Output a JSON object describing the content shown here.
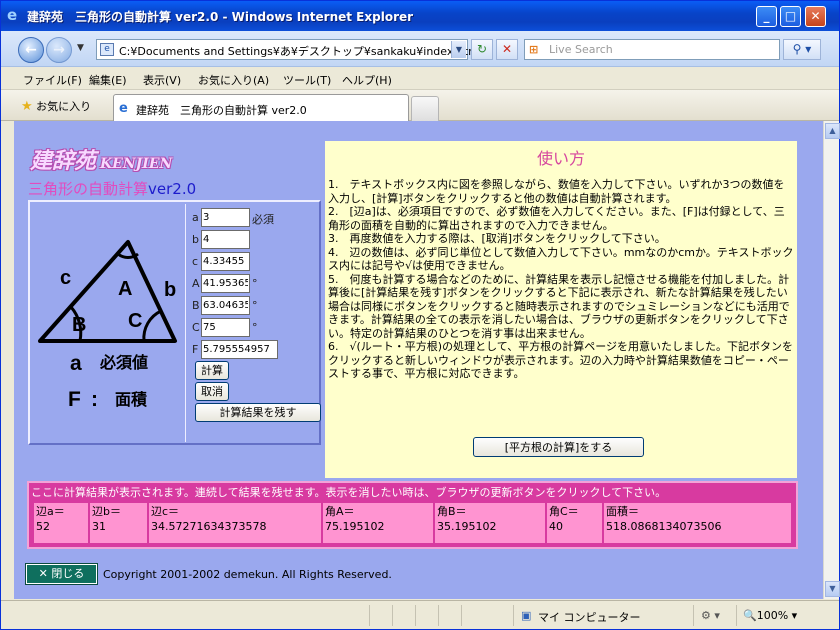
{
  "window": {
    "title": "建辞苑　三角形の自動計算 ver2.0 - Windows Internet Explorer",
    "minimize": "_",
    "maximize": "□",
    "close": "✕"
  },
  "address": {
    "url": "C:¥Documents and Settings¥あ¥デスクトップ¥sankaku¥index.htm",
    "search_placeholder": "Live Search"
  },
  "menu": [
    "ファイル(F)",
    "編集(E)",
    "表示(V)",
    "お気に入り(A)",
    "ツール(T)",
    "ヘルプ(H)"
  ],
  "favorites_label": "お気に入り",
  "tab_title": "建辞苑　三角形の自動計算 ver2.0",
  "page": {
    "logo_kanji": "建辞苑",
    "logo_en": "KENJIEN",
    "app_title": "三角形の自動計算",
    "app_version": "ver2.0",
    "diagram": {
      "label_c": "c",
      "label_b": "b",
      "label_A": "A",
      "label_B": "B",
      "label_C": "C",
      "label_a": "a",
      "required": "必須値",
      "label_F": "F",
      "colon": ":",
      "area": "面積"
    },
    "form": {
      "a": {
        "label": "a",
        "value": "3",
        "suffix": "必須"
      },
      "b": {
        "label": "b",
        "value": "4"
      },
      "c": {
        "label": "c",
        "value": "4.33455"
      },
      "A": {
        "label": "A",
        "value": "41.95365",
        "suffix": "°"
      },
      "B": {
        "label": "B",
        "value": "63.04635",
        "suffix": "°"
      },
      "C": {
        "label": "C",
        "value": "75",
        "suffix": "°"
      },
      "F": {
        "label": "F",
        "value": "5.795554957"
      },
      "calc_button": "計算",
      "cancel_button": "取消",
      "keep_button": "計算結果を残す"
    },
    "help": {
      "heading": "使い方",
      "items": [
        "1.　テキストボックス内に図を参照しながら、数値を入力して下さい。いずれか3つの数値を入力し、[計算]ボタンをクリックすると他の数値は自動計算されます。",
        "2.　[辺a]は、必須項目ですので、必ず数値を入力してください。また、[F]は付録として、三角形の面積を自動的に算出されますので入力できません。",
        "3.　再度数値を入力する際は、[取消]ボタンをクリックして下さい。",
        "4.　辺の数値は、必ず同じ単位として数値入力して下さい。mmなのかcmか。テキストボックス内には記号や√は使用できません。",
        "5.　何度も計算する場合などのために、計算結果を表示し記憶させる機能を付加しました。計算後に[計算結果を残す]ボタンをクリックすると下記に表示され、新たな計算結果を残したい場合は同様にボタンをクリックすると随時表示されますのでシュミレーションなどにも活用できます。計算結果の全ての表示を消したい場合は、ブラウザの更新ボタンをクリックして下さい。特定の計算結果のひとつを消す事は出来ません。",
        "6.　√(ルート・平方根)の処理として、平方根の計算ページを用意いたしました。下記ボタンをクリックすると新しいウィンドウが表示されます。辺の入力時や計算結果数値をコピー・ペーストする事で、平方根に対応できます。"
      ],
      "sqrt_button": "[平方根の計算]をする"
    },
    "results": {
      "note": "ここに計算結果が表示されます。連続して結果を残せます。表示を消したい時は、ブラウザの更新ボタンをクリックして下さい。",
      "columns": [
        {
          "header": "辺a＝",
          "value": "52"
        },
        {
          "header": "辺b＝",
          "value": "31"
        },
        {
          "header": "辺c＝",
          "value": "34.57271634373578"
        },
        {
          "header": "角A＝",
          "value": "75.195102"
        },
        {
          "header": "角B＝",
          "value": "35.195102"
        },
        {
          "header": "角C＝",
          "value": "40"
        },
        {
          "header": "面積＝",
          "value": "518.0868134073506"
        }
      ]
    },
    "close_button": "✕ 閉じる",
    "copyright": "Copyright 2001-2002 demekun. All Rights Reserved."
  },
  "status": {
    "zone": "マイ コンピューター",
    "zoom": "100%"
  }
}
